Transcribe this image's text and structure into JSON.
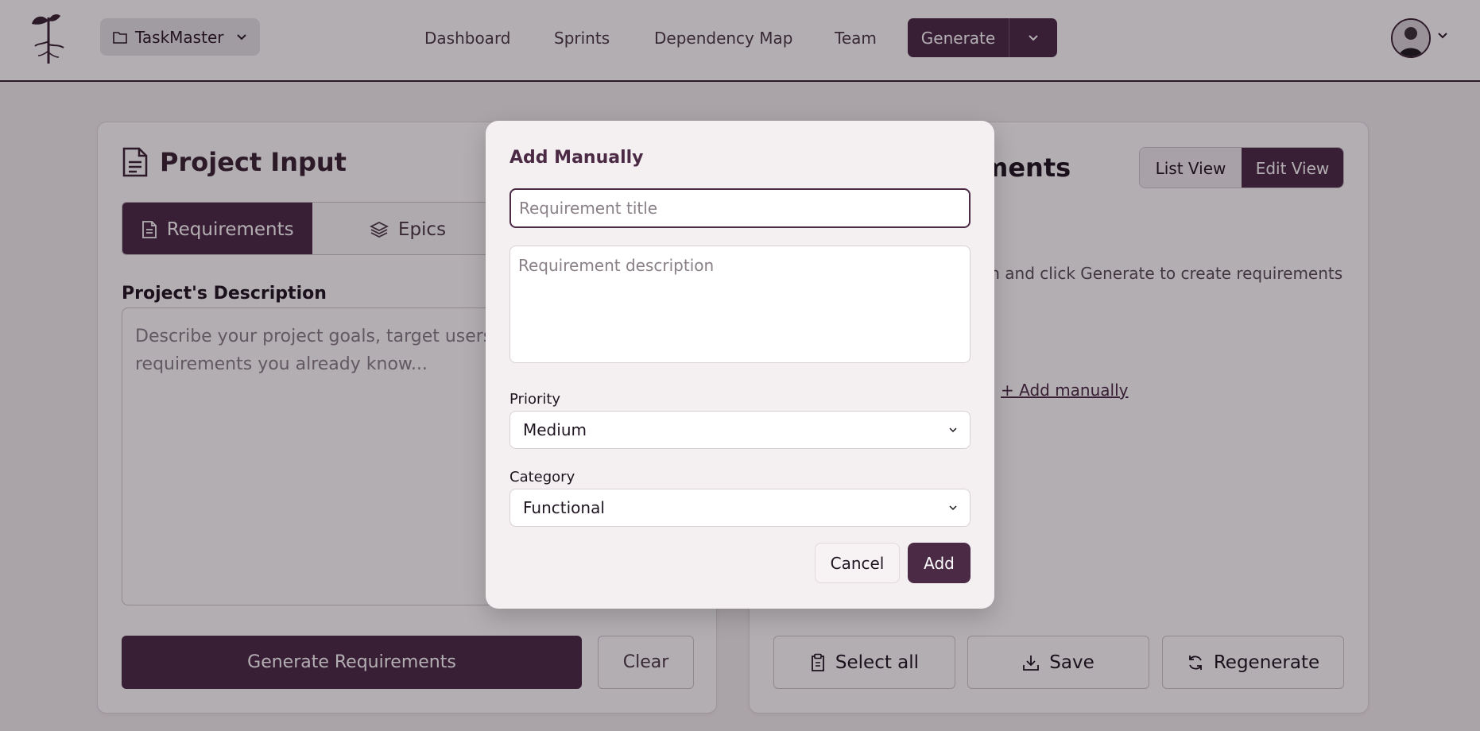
{
  "header": {
    "project_name": "TaskMaster",
    "nav": [
      "Dashboard",
      "Sprints",
      "Dependency Map",
      "Team"
    ],
    "generate_label": "Generate"
  },
  "left_card": {
    "title": "Project Input",
    "tabs": [
      "Requirements",
      "Epics"
    ],
    "description_label": "Project's Description",
    "description_placeholder": "Describe your project goals, target users, and any specific requirements you already know...",
    "generate_button": "Generate Requirements",
    "clear_button": "Clear"
  },
  "right_card": {
    "title_visible": "ments",
    "view_toggle": [
      "List View",
      "Edit View"
    ],
    "empty_text": "on and click Generate to create requirements",
    "add_manually_link": "+ Add manually",
    "actions": [
      "Select all",
      "Save",
      "Regenerate"
    ]
  },
  "modal": {
    "title": "Add Manually",
    "title_placeholder": "Requirement title",
    "description_placeholder": "Requirement description",
    "priority_label": "Priority",
    "priority_value": "Medium",
    "category_label": "Category",
    "category_value": "Functional",
    "cancel_label": "Cancel",
    "add_label": "Add"
  },
  "colors": {
    "brand": "#4b2a45",
    "overlay": "rgba(20,10,20,0.33)"
  }
}
